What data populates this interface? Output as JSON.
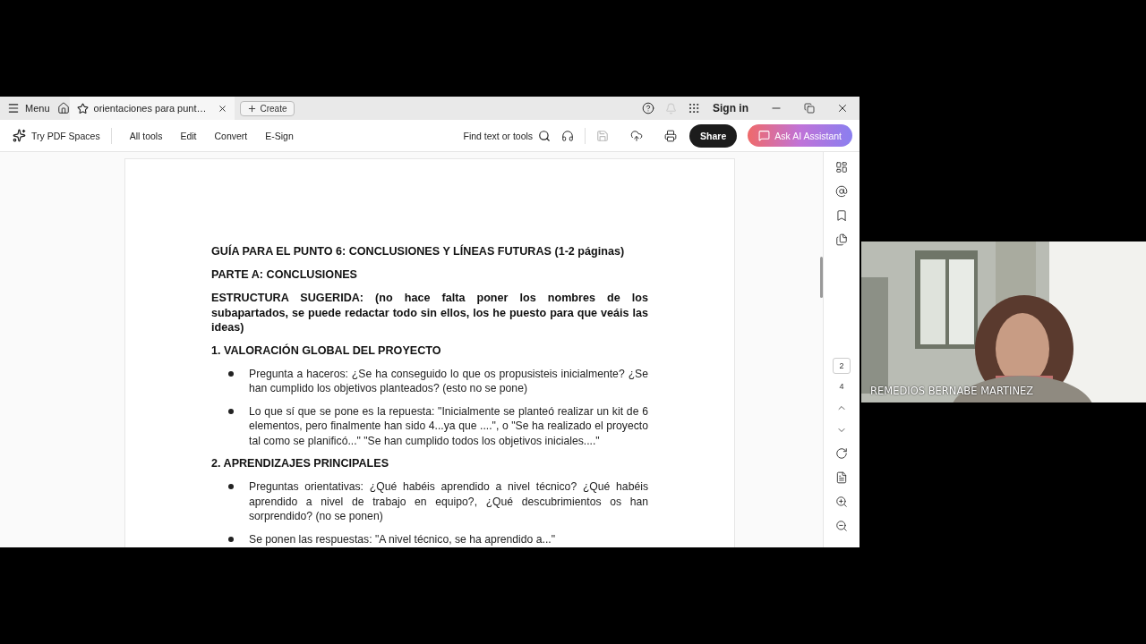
{
  "titlebar": {
    "menu": "Menu",
    "tab": {
      "title": "orientaciones para punt…",
      "selected": true
    },
    "create": "Create",
    "sign_in": "Sign in"
  },
  "toolbar": {
    "spaces": "Try PDF Spaces",
    "tools": [
      "All tools",
      "Edit",
      "Convert",
      "E-Sign"
    ],
    "search": "Find text or tools",
    "share": "Share",
    "ai": "Ask AI Assistant"
  },
  "document": [
    {
      "kind": "heading",
      "text": "GUÍA PARA EL PUNTO 6: CONCLUSIONES Y LÍNEAS FUTURAS (1-2 páginas)"
    },
    {
      "kind": "heading",
      "text": "PARTE A: CONCLUSIONES"
    },
    {
      "kind": "paragraph",
      "text": "ESTRUCTURA SUGERIDA: (no hace falta poner los nombres de los subapartados, se puede redactar todo sin ellos, los he puesto para que veáis las ideas)"
    },
    {
      "kind": "heading",
      "text": "1. VALORACIÓN GLOBAL DEL PROYECTO"
    },
    {
      "kind": "bullet",
      "text": "Pregunta a haceros: ¿Se ha conseguido lo que os propusisteis inicialmente? ¿Se han cumplido los objetivos planteados? (esto no se pone)"
    },
    {
      "kind": "bullet",
      "text": "Lo que sí que se pone es la repuesta: \"Inicialmente se planteó realizar un kit de 6 elementos, pero finalmente han sido 4...ya que ....\", o \"Se ha realizado el proyecto tal como se planificó...\" \"Se han cumplido todos los objetivos iniciales....\""
    },
    {
      "kind": "heading",
      "text": "2. APRENDIZAJES PRINCIPALES"
    },
    {
      "kind": "bullet",
      "text": "Preguntas orientativas: ¿Qué habéis aprendido a nivel técnico?  ¿Qué habéis aprendido a nivel de trabajo en equipo?, ¿Qué descubrimientos os han sorprendido? (no se ponen)"
    },
    {
      "kind": "bullet",
      "text": "Se ponen las respuestas: \"A nivel técnico, se ha aprendido a...\""
    }
  ],
  "page_nav": {
    "current": "2",
    "total": "4"
  },
  "video": {
    "name": "REMEDIOS BERNABE MARTINEZ"
  }
}
